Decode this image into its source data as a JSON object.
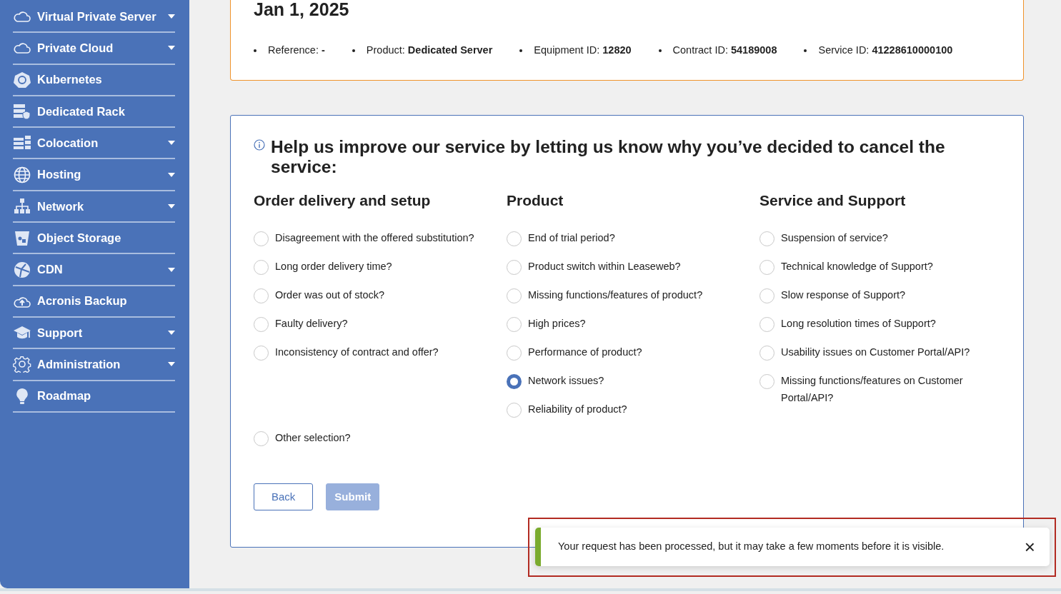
{
  "sidebar": {
    "items": [
      {
        "label": "Virtual Private Server",
        "has_submenu": true
      },
      {
        "label": "Private Cloud",
        "has_submenu": true
      },
      {
        "label": "Kubernetes",
        "has_submenu": false
      },
      {
        "label": "Dedicated Rack",
        "has_submenu": false
      },
      {
        "label": "Colocation",
        "has_submenu": true
      },
      {
        "label": "Hosting",
        "has_submenu": true
      },
      {
        "label": "Network",
        "has_submenu": true
      },
      {
        "label": "Object Storage",
        "has_submenu": false
      },
      {
        "label": "CDN",
        "has_submenu": true
      },
      {
        "label": "Acronis Backup",
        "has_submenu": false
      },
      {
        "label": "Support",
        "has_submenu": true
      },
      {
        "label": "Administration",
        "has_submenu": true
      },
      {
        "label": "Roadmap",
        "has_submenu": false
      }
    ]
  },
  "contract_card": {
    "date": "Jan 1, 2025",
    "details": [
      {
        "label": "Reference:",
        "value": "-"
      },
      {
        "label": "Product:",
        "value": "Dedicated Server"
      },
      {
        "label": "Equipment ID:",
        "value": "12820"
      },
      {
        "label": "Contract ID:",
        "value": "54189008"
      },
      {
        "label": "Service ID:",
        "value": "41228610000100"
      }
    ]
  },
  "survey": {
    "title": "Help us improve our service by letting us know why you’ve decided to cancel the service:",
    "columns": [
      {
        "heading": "Order delivery and setup",
        "options": [
          {
            "label": "Disagreement with the offered substitution?",
            "selected": false
          },
          {
            "label": "Long order delivery time?",
            "selected": false
          },
          {
            "label": "Order was out of stock?",
            "selected": false
          },
          {
            "label": "Faulty delivery?",
            "selected": false
          },
          {
            "label": "Inconsistency of contract and offer?",
            "selected": false
          }
        ]
      },
      {
        "heading": "Product",
        "options": [
          {
            "label": "End of trial period?",
            "selected": false
          },
          {
            "label": "Product switch within Leaseweb?",
            "selected": false
          },
          {
            "label": "Missing functions/features of product?",
            "selected": false
          },
          {
            "label": "High prices?",
            "selected": false
          },
          {
            "label": "Performance of product?",
            "selected": false
          },
          {
            "label": "Network issues?",
            "selected": true
          },
          {
            "label": "Reliability of product?",
            "selected": false
          }
        ]
      },
      {
        "heading": "Service and Support",
        "options": [
          {
            "label": "Suspension of service?",
            "selected": false
          },
          {
            "label": "Technical knowledge of Support?",
            "selected": false
          },
          {
            "label": "Slow response of Support?",
            "selected": false
          },
          {
            "label": "Long resolution times of Support?",
            "selected": false
          },
          {
            "label": "Usability issues on Customer Portal/API?",
            "selected": false
          },
          {
            "label": "Missing functions/features on Customer Portal/API?",
            "selected": false
          }
        ]
      }
    ],
    "other_option": {
      "label": "Other selection?",
      "selected": false
    },
    "buttons": [
      {
        "label": "Back",
        "disabled": false
      },
      {
        "label": "Submit",
        "disabled": true
      }
    ]
  },
  "toast": {
    "message": "Your request has been processed, but it may take a few moments before it is visible.",
    "close": "×"
  }
}
